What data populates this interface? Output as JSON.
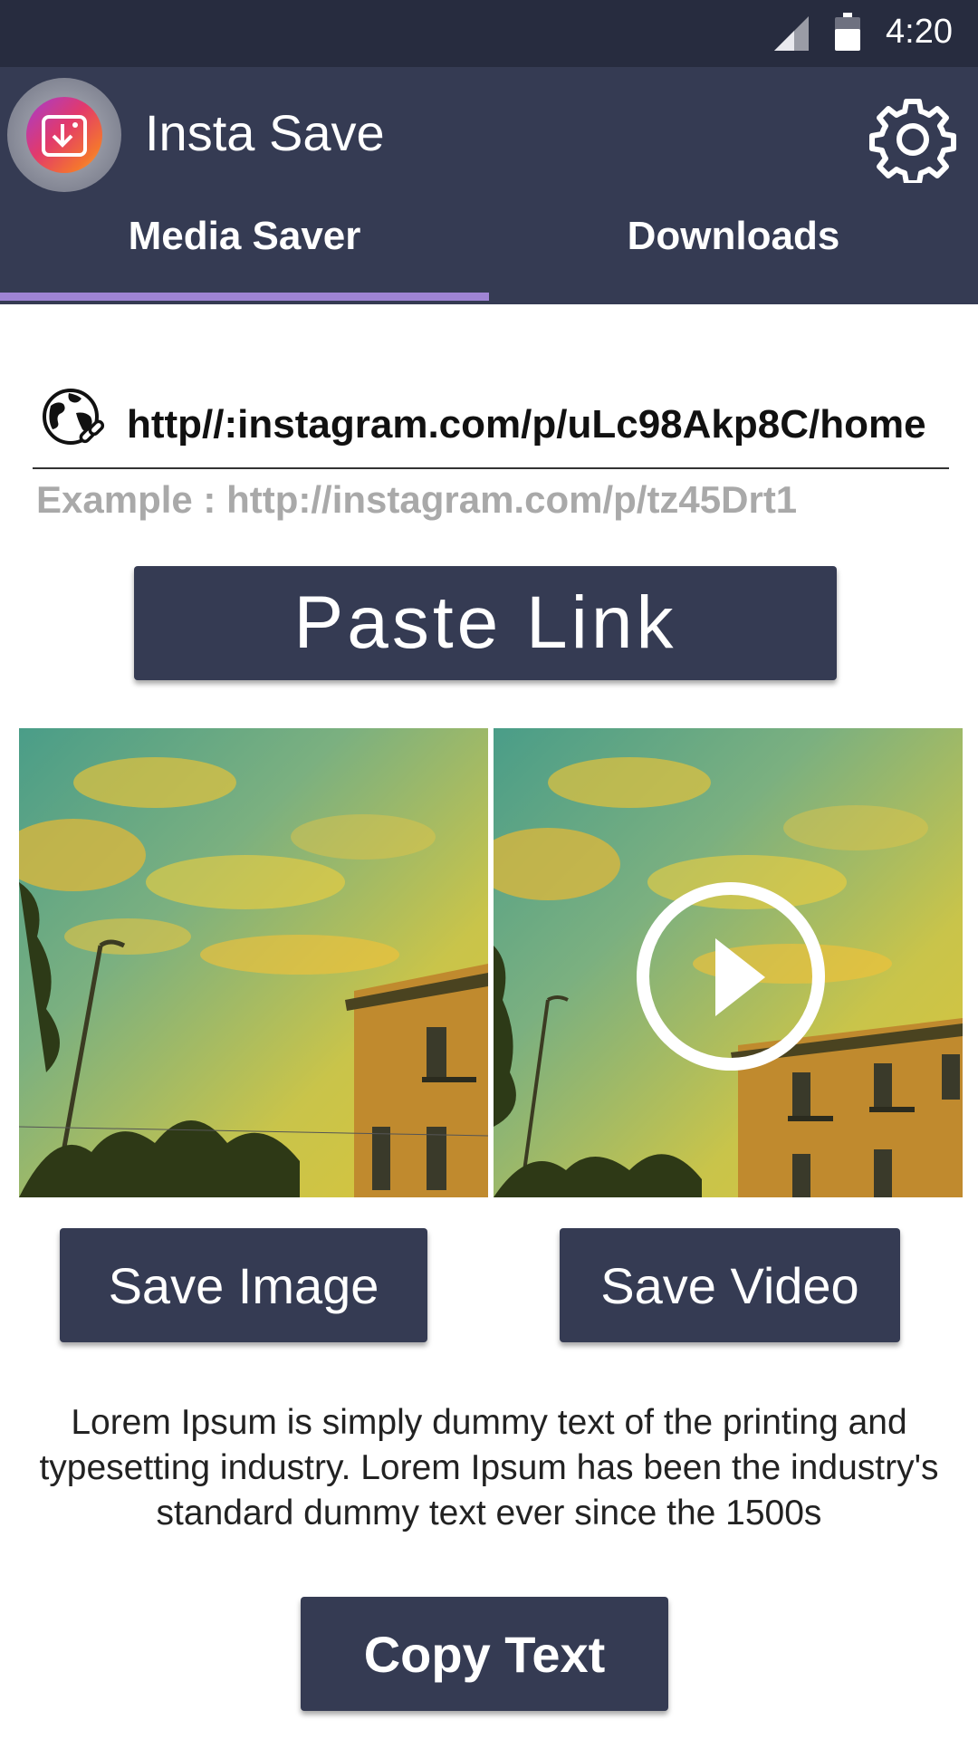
{
  "status_bar": {
    "time": "4:20"
  },
  "app_bar": {
    "title": "Insta Save"
  },
  "tabs": [
    {
      "label": "Media Saver",
      "active": true
    },
    {
      "label": "Downloads",
      "active": false
    }
  ],
  "url_input": {
    "value": "http//:instagram.com/p/uLc98Akp8C/home",
    "example": "Example : http://instagram.com/p/tz45Drt1"
  },
  "buttons": {
    "paste_link": "Paste Link",
    "save_image": "Save Image",
    "save_video": "Save Video",
    "copy_text": "Copy Text"
  },
  "media": {
    "image_preview_icon": "photo",
    "video_preview_icon": "play-circle-icon"
  },
  "description": "Lorem Ipsum is simply dummy text of the printing and typesetting industry. Lorem Ipsum has been the industry's standard dummy text ever since the 1500s",
  "colors": {
    "primary": "#353b53",
    "status_bar": "#272c3f",
    "tab_indicator": "#9f84d4",
    "example_text": "#a9a9a9"
  }
}
